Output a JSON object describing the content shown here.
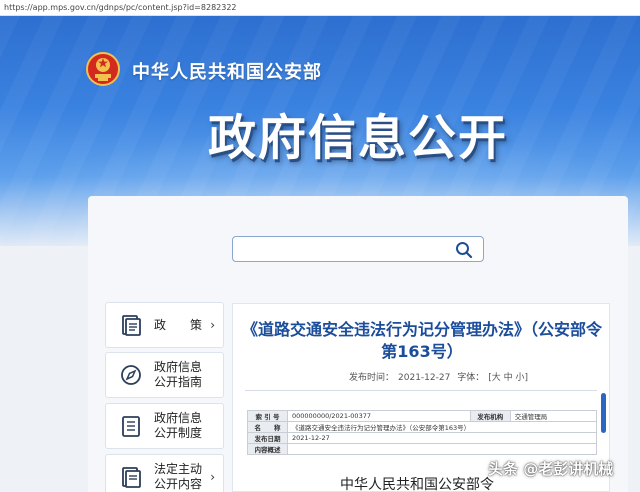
{
  "browser": {
    "url": "https://app.mps.gov.cn/gdnps/pc/content.jsp?id=8282322"
  },
  "header": {
    "ministry_name": "中华人民共和国公安部",
    "page_title": "政府信息公开",
    "emblem_icon": "national-emblem-icon"
  },
  "search": {
    "value": "",
    "icon": "search-icon"
  },
  "sidebar": {
    "items": [
      {
        "label_1": "政　　策",
        "label_2": "",
        "icon": "document-icon",
        "has_chevron": true
      },
      {
        "label_1": "政府信息",
        "label_2": "公开指南",
        "icon": "compass-icon",
        "has_chevron": false
      },
      {
        "label_1": "政府信息",
        "label_2": "公开制度",
        "icon": "list-icon",
        "has_chevron": false
      },
      {
        "label_1": "法定主动",
        "label_2": "公开内容",
        "icon": "document-icon",
        "has_chevron": true
      }
    ],
    "chevron": "›"
  },
  "article": {
    "title_line1": "《道路交通安全违法行为记分管理办法》（公安部令",
    "title_line2": "第163号）",
    "publish_label": "发布时间：",
    "publish_date": "2021-12-27",
    "font_label": "字体：",
    "font_options": "[大 中 小]",
    "table": {
      "index_label": "索 引 号",
      "index_value": "000000000/2021-00377",
      "agency_label": "发布机构",
      "agency_value": "交通管理局",
      "name_label": "名　　称",
      "name_value": "《道路交通安全违法行为记分管理办法》（公安部令第163号）",
      "date_label": "发布日期",
      "date_value": "2021-12-27",
      "summary_label": "内容概述",
      "summary_value": ""
    },
    "sub_heading": "中华人民共和国公安部令"
  },
  "watermark": "头条 @老彭讲机械",
  "colors": {
    "banner_blue": "#3a82e0",
    "title_blue": "#1b4d9b",
    "scroll_blue": "#2b66c0"
  }
}
